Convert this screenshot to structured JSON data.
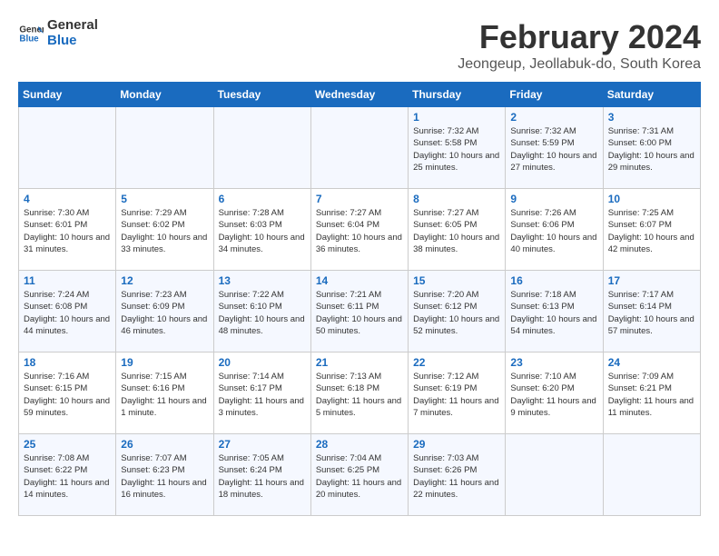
{
  "logo": {
    "text_general": "General",
    "text_blue": "Blue"
  },
  "title": "February 2024",
  "location": "Jeongeup, Jeollabuk-do, South Korea",
  "weekdays": [
    "Sunday",
    "Monday",
    "Tuesday",
    "Wednesday",
    "Thursday",
    "Friday",
    "Saturday"
  ],
  "weeks": [
    [
      {
        "day": "",
        "info": ""
      },
      {
        "day": "",
        "info": ""
      },
      {
        "day": "",
        "info": ""
      },
      {
        "day": "",
        "info": ""
      },
      {
        "day": "1",
        "info": "Sunrise: 7:32 AM\nSunset: 5:58 PM\nDaylight: 10 hours and 25 minutes."
      },
      {
        "day": "2",
        "info": "Sunrise: 7:32 AM\nSunset: 5:59 PM\nDaylight: 10 hours and 27 minutes."
      },
      {
        "day": "3",
        "info": "Sunrise: 7:31 AM\nSunset: 6:00 PM\nDaylight: 10 hours and 29 minutes."
      }
    ],
    [
      {
        "day": "4",
        "info": "Sunrise: 7:30 AM\nSunset: 6:01 PM\nDaylight: 10 hours and 31 minutes."
      },
      {
        "day": "5",
        "info": "Sunrise: 7:29 AM\nSunset: 6:02 PM\nDaylight: 10 hours and 33 minutes."
      },
      {
        "day": "6",
        "info": "Sunrise: 7:28 AM\nSunset: 6:03 PM\nDaylight: 10 hours and 34 minutes."
      },
      {
        "day": "7",
        "info": "Sunrise: 7:27 AM\nSunset: 6:04 PM\nDaylight: 10 hours and 36 minutes."
      },
      {
        "day": "8",
        "info": "Sunrise: 7:27 AM\nSunset: 6:05 PM\nDaylight: 10 hours and 38 minutes."
      },
      {
        "day": "9",
        "info": "Sunrise: 7:26 AM\nSunset: 6:06 PM\nDaylight: 10 hours and 40 minutes."
      },
      {
        "day": "10",
        "info": "Sunrise: 7:25 AM\nSunset: 6:07 PM\nDaylight: 10 hours and 42 minutes."
      }
    ],
    [
      {
        "day": "11",
        "info": "Sunrise: 7:24 AM\nSunset: 6:08 PM\nDaylight: 10 hours and 44 minutes."
      },
      {
        "day": "12",
        "info": "Sunrise: 7:23 AM\nSunset: 6:09 PM\nDaylight: 10 hours and 46 minutes."
      },
      {
        "day": "13",
        "info": "Sunrise: 7:22 AM\nSunset: 6:10 PM\nDaylight: 10 hours and 48 minutes."
      },
      {
        "day": "14",
        "info": "Sunrise: 7:21 AM\nSunset: 6:11 PM\nDaylight: 10 hours and 50 minutes."
      },
      {
        "day": "15",
        "info": "Sunrise: 7:20 AM\nSunset: 6:12 PM\nDaylight: 10 hours and 52 minutes."
      },
      {
        "day": "16",
        "info": "Sunrise: 7:18 AM\nSunset: 6:13 PM\nDaylight: 10 hours and 54 minutes."
      },
      {
        "day": "17",
        "info": "Sunrise: 7:17 AM\nSunset: 6:14 PM\nDaylight: 10 hours and 57 minutes."
      }
    ],
    [
      {
        "day": "18",
        "info": "Sunrise: 7:16 AM\nSunset: 6:15 PM\nDaylight: 10 hours and 59 minutes."
      },
      {
        "day": "19",
        "info": "Sunrise: 7:15 AM\nSunset: 6:16 PM\nDaylight: 11 hours and 1 minute."
      },
      {
        "day": "20",
        "info": "Sunrise: 7:14 AM\nSunset: 6:17 PM\nDaylight: 11 hours and 3 minutes."
      },
      {
        "day": "21",
        "info": "Sunrise: 7:13 AM\nSunset: 6:18 PM\nDaylight: 11 hours and 5 minutes."
      },
      {
        "day": "22",
        "info": "Sunrise: 7:12 AM\nSunset: 6:19 PM\nDaylight: 11 hours and 7 minutes."
      },
      {
        "day": "23",
        "info": "Sunrise: 7:10 AM\nSunset: 6:20 PM\nDaylight: 11 hours and 9 minutes."
      },
      {
        "day": "24",
        "info": "Sunrise: 7:09 AM\nSunset: 6:21 PM\nDaylight: 11 hours and 11 minutes."
      }
    ],
    [
      {
        "day": "25",
        "info": "Sunrise: 7:08 AM\nSunset: 6:22 PM\nDaylight: 11 hours and 14 minutes."
      },
      {
        "day": "26",
        "info": "Sunrise: 7:07 AM\nSunset: 6:23 PM\nDaylight: 11 hours and 16 minutes."
      },
      {
        "day": "27",
        "info": "Sunrise: 7:05 AM\nSunset: 6:24 PM\nDaylight: 11 hours and 18 minutes."
      },
      {
        "day": "28",
        "info": "Sunrise: 7:04 AM\nSunset: 6:25 PM\nDaylight: 11 hours and 20 minutes."
      },
      {
        "day": "29",
        "info": "Sunrise: 7:03 AM\nSunset: 6:26 PM\nDaylight: 11 hours and 22 minutes."
      },
      {
        "day": "",
        "info": ""
      },
      {
        "day": "",
        "info": ""
      }
    ]
  ]
}
